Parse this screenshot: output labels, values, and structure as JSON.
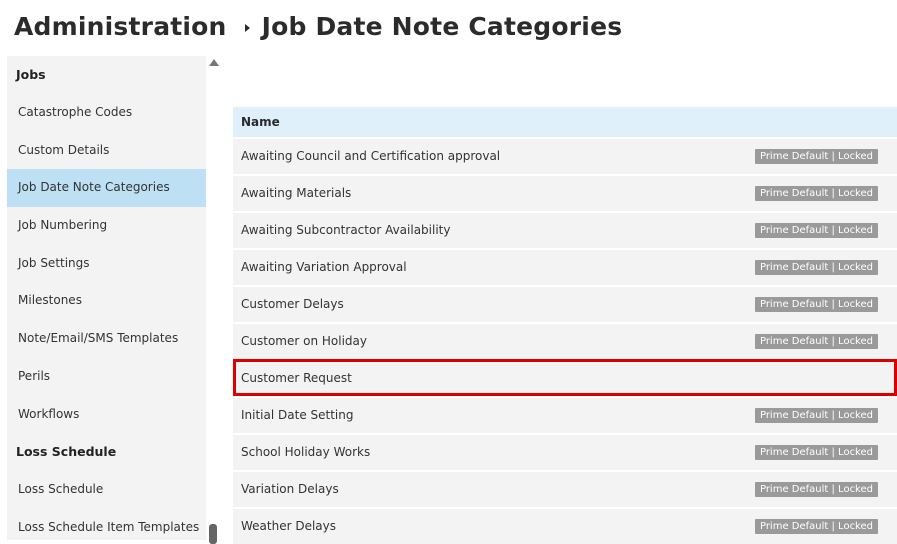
{
  "header": {
    "root": "Administration",
    "current": "Job Date Note Categories"
  },
  "sidebar": {
    "section_jobs": "Jobs",
    "items_jobs": [
      "Catastrophe Codes",
      "Custom Details",
      "Job Date Note Categories",
      "Job Numbering",
      "Job Settings",
      "Milestones",
      "Note/Email/SMS Templates",
      "Perils",
      "Workflows"
    ],
    "section_loss": "Loss Schedule",
    "items_loss": [
      "Loss Schedule",
      "Loss Schedule Item Templates"
    ],
    "active_item": "Job Date Note Categories"
  },
  "table": {
    "column_name": "Name",
    "badge_text": "Prime Default | Locked",
    "rows": [
      {
        "name": "Awaiting Council and Certification approval",
        "badge": "Prime Default | Locked"
      },
      {
        "name": "Awaiting Materials",
        "badge": "Prime Default | Locked"
      },
      {
        "name": "Awaiting Subcontractor Availability",
        "badge": "Prime Default | Locked"
      },
      {
        "name": "Awaiting Variation Approval",
        "badge": "Prime Default | Locked"
      },
      {
        "name": "Customer Delays",
        "badge": "Prime Default | Locked"
      },
      {
        "name": "Customer on Holiday",
        "badge": "Prime Default | Locked"
      },
      {
        "name": "Customer Request",
        "badge": ""
      },
      {
        "name": "Initial Date Setting",
        "badge": "Prime Default | Locked"
      },
      {
        "name": "School Holiday Works",
        "badge": "Prime Default | Locked"
      },
      {
        "name": "Variation Delays",
        "badge": "Prime Default | Locked"
      },
      {
        "name": "Weather Delays",
        "badge": "Prime Default | Locked"
      }
    ],
    "highlighted_row": "Customer Request"
  },
  "colors": {
    "active_sidebar": "#bde0f4",
    "table_header": "#dff0fb",
    "badge": "#9a9a9a",
    "highlight_border": "#dd0000"
  }
}
